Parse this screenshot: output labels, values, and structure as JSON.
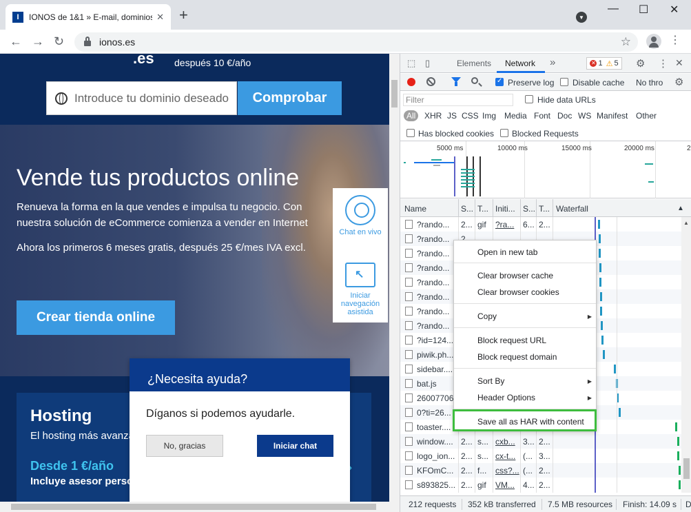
{
  "browser": {
    "tab_title": "IONOS de 1&1 » E-mail, dominios, hosting",
    "tab_favicon": "I",
    "tab_close": "✕",
    "new_tab": "+",
    "url": "ionos.es",
    "window_controls": [
      "—",
      "☐",
      "✕"
    ]
  },
  "page": {
    "domain_suffix": ".es",
    "price_after": "después 10 €/año",
    "domain_placeholder": "Introduce tu dominio deseado",
    "check_button": "Comprobar",
    "hero_title": "Vende tus productos online",
    "hero_sub_line1": "Renueva la forma en la que vendes e impulsa tu negocio. Con",
    "hero_sub_line2": "nuestra solución de eCommerce comienza a vender en Internet",
    "hero_promo": "Ahora los primeros 6 meses gratis, después 25 €/mes IVA excl.",
    "shop_button": "Crear tienda online",
    "side_chat": "Chat en vivo",
    "side_nav": "Iniciar navegación asistida",
    "hosting_title": "Hosting",
    "hosting_sub": "El hosting más avanzado",
    "hosting_price": "Desde 1 €/año",
    "hosting_extra": "Incluye asesor personal",
    "hosting_arrow": "›"
  },
  "chat": {
    "title": "¿Necesita ayuda?",
    "message": "Díganos si podemos ayudarle.",
    "no_button": "No, gracias",
    "start_button": "Iniciar chat"
  },
  "devtools": {
    "tabs": [
      "Elements",
      "Network"
    ],
    "more_tabs": "»",
    "errors": "1",
    "warnings": "5",
    "preserve_log": "Preserve log",
    "disable_cache": "Disable cache",
    "throttle": "No thro",
    "filter_placeholder": "Filter",
    "hide_data_urls": "Hide data URLs",
    "types": [
      "All",
      "XHR",
      "JS",
      "CSS",
      "Img",
      "Media",
      "Font",
      "Doc",
      "WS",
      "Manifest",
      "Other"
    ],
    "blocked_cookies": "Has blocked cookies",
    "blocked_requests": "Blocked Requests",
    "timeline_labels": [
      "5000 ms",
      "10000 ms",
      "15000 ms",
      "20000 ms",
      "2"
    ],
    "columns": [
      "Name",
      "S...",
      "T...",
      "Initi...",
      "S...",
      "T...",
      "Waterfall"
    ],
    "rows": [
      {
        "name": "?rando...",
        "s": "2...",
        "t": "gif",
        "init": "?ra...",
        "size": "6...",
        "time": "2..."
      },
      {
        "name": "?rando...",
        "s": "2...",
        "t": "",
        "init": "",
        "size": "",
        "time": ""
      },
      {
        "name": "?rando...",
        "s": "",
        "t": "",
        "init": "",
        "size": "",
        "time": ""
      },
      {
        "name": "?rando...",
        "s": "",
        "t": "",
        "init": "",
        "size": "",
        "time": ""
      },
      {
        "name": "?rando...",
        "s": "",
        "t": "",
        "init": "",
        "size": "",
        "time": ""
      },
      {
        "name": "?rando...",
        "s": "",
        "t": "",
        "init": "",
        "size": "",
        "time": ""
      },
      {
        "name": "?rando...",
        "s": "",
        "t": "",
        "init": "",
        "size": "",
        "time": ""
      },
      {
        "name": "?rando...",
        "s": "",
        "t": "",
        "init": "",
        "size": "",
        "time": ""
      },
      {
        "name": "?id=124...",
        "s": "",
        "t": "",
        "init": "",
        "size": "",
        "time": ""
      },
      {
        "name": "piwik.ph...",
        "s": "",
        "t": "",
        "init": "",
        "size": "",
        "time": ""
      },
      {
        "name": "sidebar....",
        "s": "",
        "t": "",
        "init": "",
        "size": "",
        "time": ""
      },
      {
        "name": "bat.js",
        "s": "",
        "t": "",
        "init": "",
        "size": "",
        "time": ""
      },
      {
        "name": "26007706",
        "s": "",
        "t": "",
        "init": "",
        "size": "",
        "time": ""
      },
      {
        "name": "0?ti=26...",
        "s": "",
        "t": "",
        "init": "",
        "size": "",
        "time": ""
      },
      {
        "name": "toaster....",
        "s": "",
        "t": "",
        "init": "",
        "size": "",
        "time": ""
      },
      {
        "name": "window....",
        "s": "2...",
        "t": "s...",
        "init": "cxb...",
        "size": "3...",
        "time": "2..."
      },
      {
        "name": "logo_ion...",
        "s": "2...",
        "t": "s...",
        "init": "cx-t...",
        "size": "(...",
        "time": "3..."
      },
      {
        "name": "KFOmC...",
        "s": "2...",
        "t": "f...",
        "init": "css?...",
        "size": "(...",
        "time": "2..."
      },
      {
        "name": "s893825...",
        "s": "2...",
        "t": "gif",
        "init": "VM...",
        "size": "4...",
        "time": "2..."
      }
    ],
    "status": {
      "requests": "212 requests",
      "transferred": "352 kB transferred",
      "resources": "7.5 MB resources",
      "finish": "Finish: 14.09 s",
      "more": "D"
    }
  },
  "context_menu": {
    "items": [
      "Open in new tab",
      "Clear browser cache",
      "Clear browser cookies",
      "Copy",
      "Block request URL",
      "Block request domain",
      "Sort By",
      "Header Options",
      "Save all as HAR with content"
    ],
    "submenu_arrow": "▶"
  },
  "colors": {
    "accent_blue": "#1a73e8",
    "ionos_blue": "#3b9ae1",
    "highlight_green": "#3ebd3e"
  }
}
